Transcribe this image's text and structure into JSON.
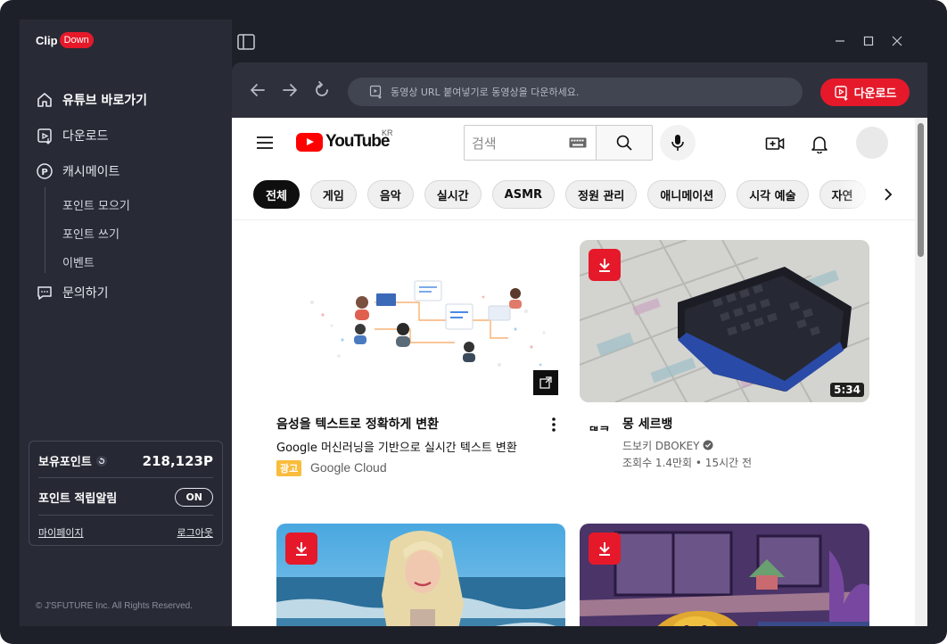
{
  "app": {
    "logo_clip": "Clip",
    "logo_down": "Down"
  },
  "sidebar": {
    "items": [
      {
        "label": "유튜브 바로가기",
        "icon": "home-icon"
      },
      {
        "label": "다운로드",
        "icon": "download-file-icon"
      },
      {
        "label": "캐시메이트",
        "icon": "point-p-icon"
      },
      {
        "label": "문의하기",
        "icon": "chat-icon"
      }
    ],
    "sub_items": [
      "포인트 모으기",
      "포인트 쓰기",
      "이벤트"
    ],
    "points": {
      "label": "보유포인트",
      "value": "218,123P",
      "alarm_label": "포인트 적립알림",
      "alarm_state": "ON",
      "mypage": "마이페이지",
      "logout": "로그아웃"
    },
    "copyright": "© J'SFUTURE Inc. All Rights Reserved."
  },
  "browser": {
    "url_placeholder": "동영상 URL 붙여넣기로 동영상을 다운하세요.",
    "download_button": "다운로드"
  },
  "youtube": {
    "logo_text": "YouTube",
    "region": "KR",
    "search_placeholder": "검색",
    "chips": [
      "전체",
      "게임",
      "음악",
      "실시간",
      "ASMR",
      "정원 관리",
      "애니메이션",
      "시각 예술",
      "자연"
    ],
    "videos": [
      {
        "title": "음성을 텍스트로 정확하게 변환",
        "subtitle": "Google 머신러닝을 기반으로 실시간 텍스트 변환",
        "ad_label": "광고",
        "advertiser": "Google Cloud"
      },
      {
        "title": "몽 세르뱅",
        "channel": "드보키 DBOKEY",
        "channel_logo": "ᄃᄇᄏ",
        "meta": "조회수 1.4만회 • 15시간 전",
        "duration": "5:34"
      }
    ]
  },
  "colors": {
    "accent": "#e5192a",
    "sidebar_bg": "#282b36",
    "app_bg": "#1e2029",
    "browser_bg": "#2e313c"
  }
}
